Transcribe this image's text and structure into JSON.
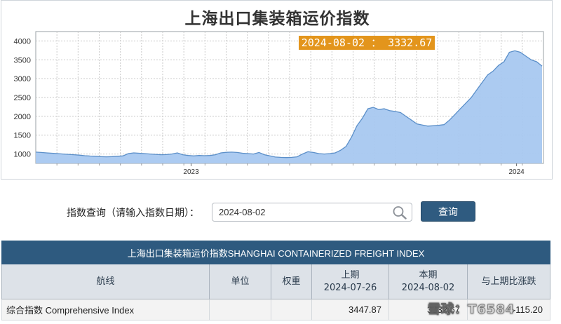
{
  "chart": {
    "title": "上海出口集装箱运价指数",
    "tooltip": "2024-08-02 ： 3332.67",
    "colors": {
      "fill": "#a8c8f0",
      "line": "#5b8fc9",
      "tooltip_bg": "#e3951c",
      "tooltip_text": "#ffffff"
    }
  },
  "chart_data": {
    "type": "area",
    "x_tick_labels": [
      "2023",
      "2024"
    ],
    "y_tick_labels": [
      "1000",
      "1500",
      "2000",
      "2500",
      "3000",
      "3500",
      "4000"
    ],
    "ylim": [
      750,
      4250
    ],
    "grid": true,
    "series": [
      {
        "values": [
          1050,
          1040,
          1030,
          1020,
          1010,
          1000,
          990,
          980,
          970,
          955,
          945,
          940,
          930,
          925,
          930,
          940,
          950,
          1010,
          1030,
          1020,
          1010,
          1000,
          990,
          980,
          985,
          1000,
          1030,
          980,
          960,
          950,
          960,
          955,
          960,
          980,
          1030,
          1045,
          1050,
          1040,
          1020,
          1010,
          1000,
          1040,
          980,
          950,
          920,
          910,
          905,
          910,
          925,
          1000,
          1060,
          1040,
          1010,
          1000,
          1010,
          1030,
          1100,
          1200,
          1450,
          1750,
          1950,
          2200,
          2240,
          2180,
          2200,
          2150,
          2130,
          2100,
          2000,
          1900,
          1800,
          1770,
          1740,
          1750,
          1760,
          1780,
          1900,
          2050,
          2200,
          2350,
          2500,
          2700,
          2900,
          3100,
          3200,
          3350,
          3450,
          3700,
          3740,
          3700,
          3600,
          3500,
          3450,
          3332.67
        ]
      }
    ]
  },
  "query": {
    "label": "指数查询（请输入指数日期）：",
    "date_value": "2024-08-02",
    "button": "查询"
  },
  "table": {
    "caption": "上海出口集装箱运价指数SHANGHAI CONTAINERIZED FREIGHT INDEX",
    "headers": {
      "route": "航线",
      "unit": "单位",
      "weight": "权重",
      "prev_title": "上期",
      "prev_date": "2024-07-26",
      "curr_title": "本期",
      "curr_date": "2024-08-02",
      "change": "与上期比涨跌"
    },
    "rows": [
      {
        "name": "综合指数 Comprehensive Index",
        "unit": "",
        "weight": "",
        "prev": "3447.87",
        "curr": "3332.67",
        "change": "-115.20"
      }
    ]
  },
  "watermark": "雪球：T6584"
}
